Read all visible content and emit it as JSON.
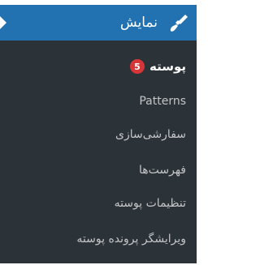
{
  "menu": {
    "title": "نمایش",
    "icon": "paintbrush-icon",
    "accent_color": "#2271b1",
    "submenu_bg": "#2c3338"
  },
  "submenu": {
    "items": [
      {
        "label": "پوسته",
        "badge": "5",
        "current": true
      },
      {
        "label": "Patterns"
      },
      {
        "label": "سفارشی‌سازی"
      },
      {
        "label": "فهرست‌ها"
      },
      {
        "label": "تنظیمات پوسته"
      },
      {
        "label": "ویرایشگر پرونده پوسته"
      }
    ]
  }
}
